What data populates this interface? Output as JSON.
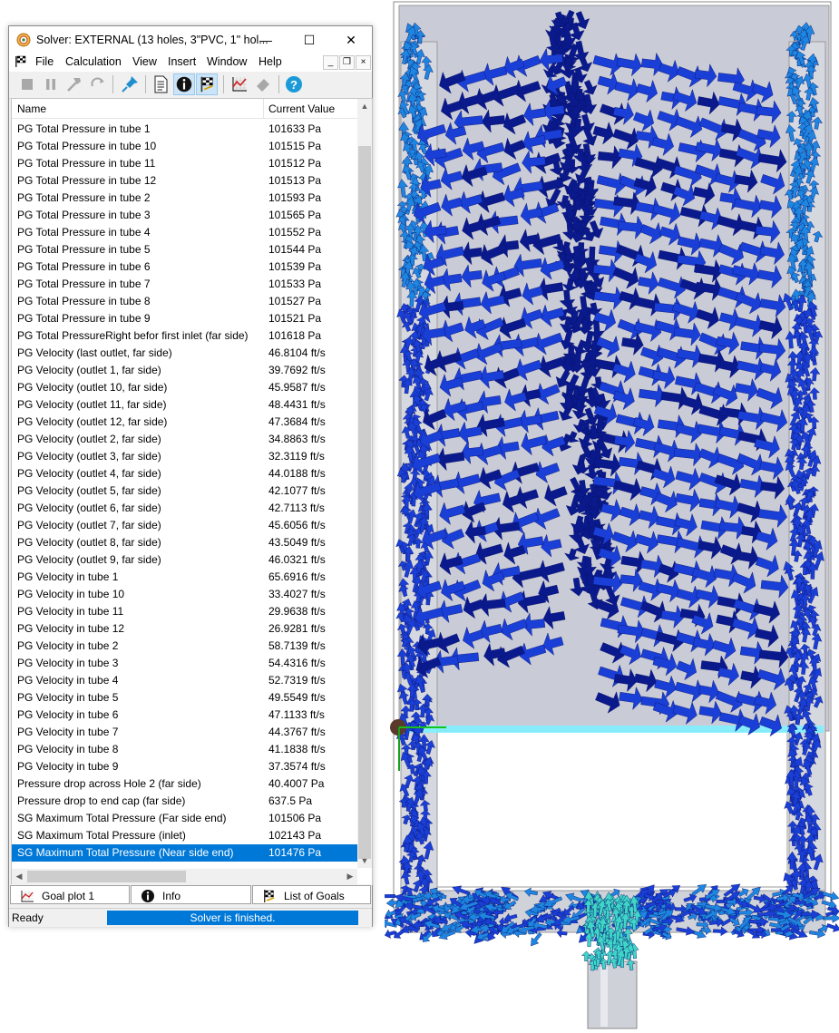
{
  "window": {
    "title": "Solver: EXTERNAL  (13 holes, 3\"PVC, 1\" hol...",
    "minimize": "—",
    "maximize": "☐",
    "close": "✕"
  },
  "menu": [
    "File",
    "Calculation",
    "View",
    "Insert",
    "Window",
    "Help"
  ],
  "mdi_buttons": [
    "_",
    "❐",
    "×"
  ],
  "toolbar_icons": [
    "stop-icon",
    "pause-icon",
    "hammer-icon",
    "refresh-icon",
    "pin-icon",
    "document-icon",
    "info-icon",
    "goals-flag-icon",
    "goal-plot-icon",
    "eraser-icon",
    "help-icon"
  ],
  "list": {
    "columns": {
      "name": "Name",
      "value": "Current Value"
    },
    "selected_index": 42,
    "rows": [
      {
        "name": "PG Total Pressure in tube 1",
        "value": "101633 Pa"
      },
      {
        "name": "PG Total Pressure in tube 10",
        "value": "101515 Pa"
      },
      {
        "name": "PG Total Pressure in tube 11",
        "value": "101512 Pa"
      },
      {
        "name": "PG Total Pressure in tube 12",
        "value": "101513 Pa"
      },
      {
        "name": "PG Total Pressure in tube 2",
        "value": "101593 Pa"
      },
      {
        "name": "PG Total Pressure in tube 3",
        "value": "101565 Pa"
      },
      {
        "name": "PG Total Pressure in tube 4",
        "value": "101552 Pa"
      },
      {
        "name": "PG Total Pressure in tube 5",
        "value": "101544 Pa"
      },
      {
        "name": "PG Total Pressure in tube 6",
        "value": "101539 Pa"
      },
      {
        "name": "PG Total Pressure in tube 7",
        "value": "101533 Pa"
      },
      {
        "name": "PG Total Pressure in tube 8",
        "value": "101527 Pa"
      },
      {
        "name": "PG Total Pressure in tube 9",
        "value": "101521 Pa"
      },
      {
        "name": "PG Total PressureRight befor first inlet (far side)",
        "value": "101618 Pa"
      },
      {
        "name": "PG Velocity (last outlet, far side)",
        "value": "46.8104 ft/s"
      },
      {
        "name": "PG Velocity (outlet 1, far side)",
        "value": "39.7692 ft/s"
      },
      {
        "name": "PG Velocity (outlet 10, far side)",
        "value": "45.9587 ft/s"
      },
      {
        "name": "PG Velocity (outlet 11, far side)",
        "value": "48.4431 ft/s"
      },
      {
        "name": "PG Velocity (outlet 12, far side)",
        "value": "47.3684 ft/s"
      },
      {
        "name": "PG Velocity (outlet 2, far side)",
        "value": "34.8863 ft/s"
      },
      {
        "name": "PG Velocity (outlet 3, far side)",
        "value": "32.3119 ft/s"
      },
      {
        "name": "PG Velocity (outlet 4, far side)",
        "value": "44.0188 ft/s"
      },
      {
        "name": "PG Velocity (outlet 5, far side)",
        "value": "42.1077 ft/s"
      },
      {
        "name": "PG Velocity (outlet 6, far side)",
        "value": "42.7113 ft/s"
      },
      {
        "name": "PG Velocity (outlet 7, far side)",
        "value": "45.6056 ft/s"
      },
      {
        "name": "PG Velocity (outlet 8, far side)",
        "value": "43.5049 ft/s"
      },
      {
        "name": "PG Velocity (outlet 9, far side)",
        "value": "46.0321 ft/s"
      },
      {
        "name": "PG Velocity in tube 1",
        "value": "65.6916 ft/s"
      },
      {
        "name": "PG Velocity in tube 10",
        "value": "33.4027 ft/s"
      },
      {
        "name": "PG Velocity in tube 11",
        "value": "29.9638 ft/s"
      },
      {
        "name": "PG Velocity in tube 12",
        "value": "26.9281 ft/s"
      },
      {
        "name": "PG Velocity in tube 2",
        "value": "58.7139 ft/s"
      },
      {
        "name": "PG Velocity in tube 3",
        "value": "54.4316 ft/s"
      },
      {
        "name": "PG Velocity in tube 4",
        "value": "52.7319 ft/s"
      },
      {
        "name": "PG Velocity in tube 5",
        "value": "49.5549 ft/s"
      },
      {
        "name": "PG Velocity in tube 6",
        "value": "47.1133 ft/s"
      },
      {
        "name": "PG Velocity in tube 7",
        "value": "44.3767 ft/s"
      },
      {
        "name": "PG Velocity in tube 8",
        "value": "41.1838 ft/s"
      },
      {
        "name": "PG Velocity in tube 9",
        "value": "37.3574 ft/s"
      },
      {
        "name": "Pressure drop across Hole 2 (far side)",
        "value": "40.4007 Pa"
      },
      {
        "name": "Pressure drop to end cap (far side)",
        "value": "637.5 Pa"
      },
      {
        "name": "SG Maximum Total Pressure (Far side end)",
        "value": "101506 Pa"
      },
      {
        "name": "SG Maximum Total Pressure (inlet)",
        "value": "102143 Pa"
      },
      {
        "name": "SG Maximum Total Pressure (Near side end)",
        "value": "101476 Pa"
      }
    ]
  },
  "tabs": [
    {
      "label": "Goal plot 1",
      "icon": "goal-plot-icon"
    },
    {
      "label": "Info",
      "icon": "info-icon"
    },
    {
      "label": "List of Goals",
      "icon": "goals-flag-icon"
    }
  ],
  "status": {
    "left": "Ready",
    "progress": "Solver is finished."
  },
  "colors": {
    "selection": "#0078d7",
    "vector_dark": "#0a1a8c",
    "vector_mid": "#1a3fd6",
    "vector_light": "#1e86e0",
    "vector_cyan": "#3fd6c8",
    "housing": "#c9cbd6"
  }
}
